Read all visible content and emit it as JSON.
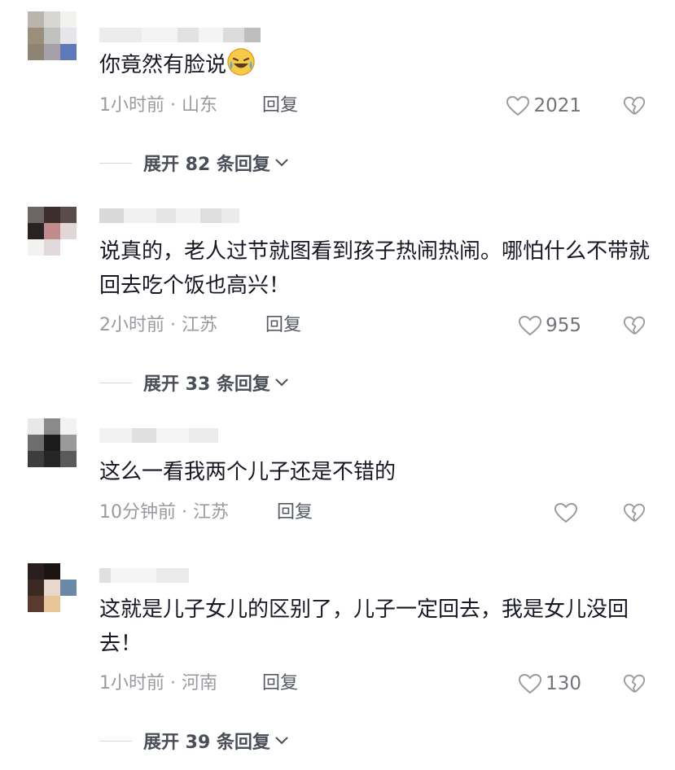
{
  "comments": [
    {
      "text": "你竟然有脸说",
      "time": "1小时前",
      "location": "山东",
      "reply_label": "回复",
      "likes": "2021",
      "expand_label": "展开 82 条回复",
      "emoji_icon": "laughing-crying-emoji-icon"
    },
    {
      "text": "说真的，老人过节就图看到孩子热闹热闹。哪怕什么不带就回去吃个饭也高兴！",
      "time": "2小时前",
      "location": "江苏",
      "reply_label": "回复",
      "likes": "955",
      "expand_label": "展开 33 条回复"
    },
    {
      "text": "这么一看我两个儿子还是不错的",
      "time": "10分钟前",
      "location": "江苏",
      "reply_label": "回复",
      "likes": ""
    },
    {
      "text": "这就是儿子女儿的区别了，儿子一定回去，我是女儿没回去！",
      "time": "1小时前",
      "location": "河南",
      "reply_label": "回复",
      "likes": "130",
      "expand_label": "展开 39 条回复"
    }
  ],
  "meta_separator": "·",
  "colors": {
    "text": "#161823",
    "meta": "#9a9aa0",
    "accent_emoji": "#f7c948"
  }
}
